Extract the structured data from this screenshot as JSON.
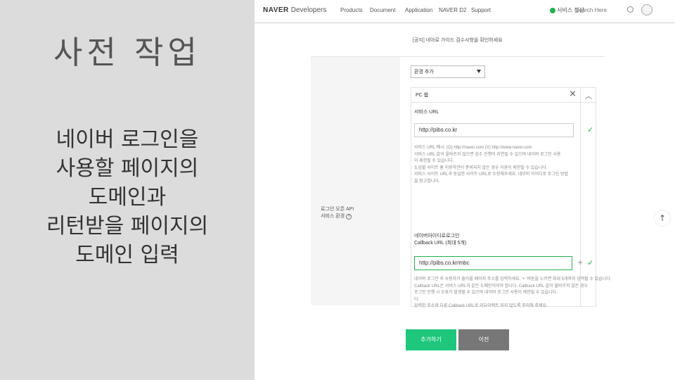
{
  "slide": {
    "title": "사전 작업",
    "body": [
      "네이버 로그인을",
      "사용할 페이지의",
      "도메인과",
      "리턴받을 페이지의",
      "도메인 입력"
    ]
  },
  "nav": {
    "logo_bold": "NAVER",
    "logo_light": "Developers",
    "items": [
      "Products",
      "Document",
      "Application",
      "NAVER D2",
      "Support"
    ],
    "status": "서비스 정상",
    "search_placeholder": "Search Here"
  },
  "form": {
    "notice": "[공지] 네아로 가이드 검수사항을 확인하세요",
    "row_label_line1": "로그인 오픈 API",
    "row_label_line2": "서비스 환경",
    "env_select_value": "환경 추가",
    "pc_title": "PC 웹",
    "service_url_label": "서비스 URL",
    "service_url_value": "http://pibs.co.kr",
    "service_url_help": [
      "서비스 URL 예시: (O) http://naver.com (X) http://www.naver.com",
      "서비스 URL 값이 올바르지 않으면 검수 진행이 지연될 수 있으며 네이버 로그인 사용",
      "이 제한될 수 있습니다.",
      "도입할 사이트 홈 이용약관이 준비되지 않은 경우 이용이 제한될 수 있습니다.",
      "서비스 사이트 URL과 동일한 사이트 URL로 수정해주세요. 네이버 아이디로 로그인 방법",
      "을 참고합니다."
    ],
    "callback_label_line1": "네이버아이디로로그인",
    "callback_label_line2": "Callback URL (최대 5개)",
    "callback_url_value": "http://pibs.co.kr/mbc",
    "callback_help": [
      "네이버 로그인 후 사용자가 돌아올 페이지 주소를 입력하세요. '+' 버튼을 누르면 최대 5개까지 입력할 수 있습니다.",
      "Callback URL은 서비스 URL과 같은 도메인이어야 합니다. Callback URL 값이 올바르지 않은 경우",
      "로그인 진행 시 오류가 발생할 수 있으며 네이버 로그인 사용이 제한될 수 있습니다.",
      "다.",
      "입력한 주소와 다른 Callback URL로 리다이렉트 되지 않도록 주의해 주세요."
    ]
  },
  "buttons": {
    "add": "추가하기",
    "prev": "이전"
  },
  "colors": {
    "accent_green": "#1ec77c",
    "prev_gray": "#777777",
    "left_bg": "#dcdcdc"
  }
}
